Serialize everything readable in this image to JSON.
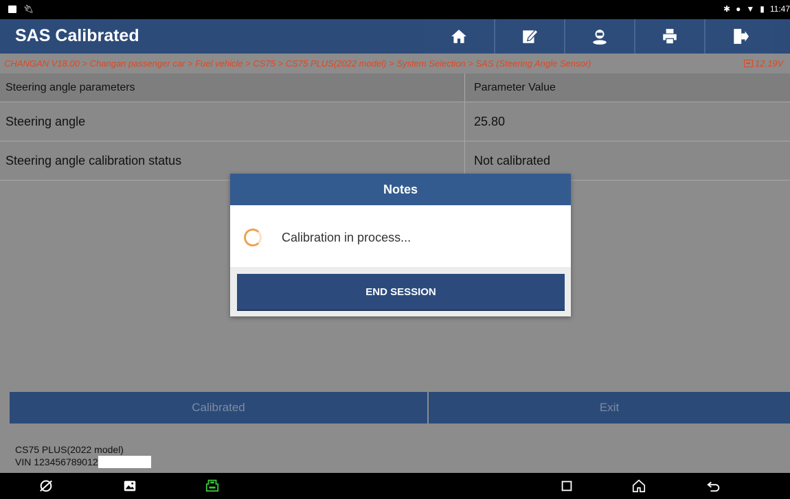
{
  "statusbar": {
    "time": "11:47"
  },
  "app": {
    "title": "SAS Calibrated"
  },
  "toolbar": {
    "icons": [
      "home-icon",
      "edit-report-icon",
      "remote-help-icon",
      "print-icon",
      "exit-icon"
    ]
  },
  "breadcrumb": {
    "path": "CHANGAN V18.00 > Changan passenger car > Fuel vehicle > CS75 > CS75 PLUS(2022 model) > System Selection > SAS (Steering Angle Sensor)",
    "voltage": "12.19V"
  },
  "table": {
    "headers": [
      "Steering angle parameters",
      "Parameter Value"
    ],
    "rows": [
      {
        "param": "Steering angle",
        "value": "25.80"
      },
      {
        "param": "Steering angle calibration status",
        "value": "Not calibrated"
      }
    ]
  },
  "actions": {
    "calibrated_label": "Calibrated",
    "exit_label": "Exit"
  },
  "vehicle": {
    "model": "CS75 PLUS(2022 model)",
    "vin": "VIN 123456789012"
  },
  "dialog": {
    "title": "Notes",
    "message": "Calibration in process...",
    "button_label": "END SESSION"
  },
  "colors": {
    "titlebar": "#2c4b78",
    "breadcrumb_text": "#e3461f",
    "dialog_header": "#345b8f",
    "spinner": "#f0a050"
  }
}
